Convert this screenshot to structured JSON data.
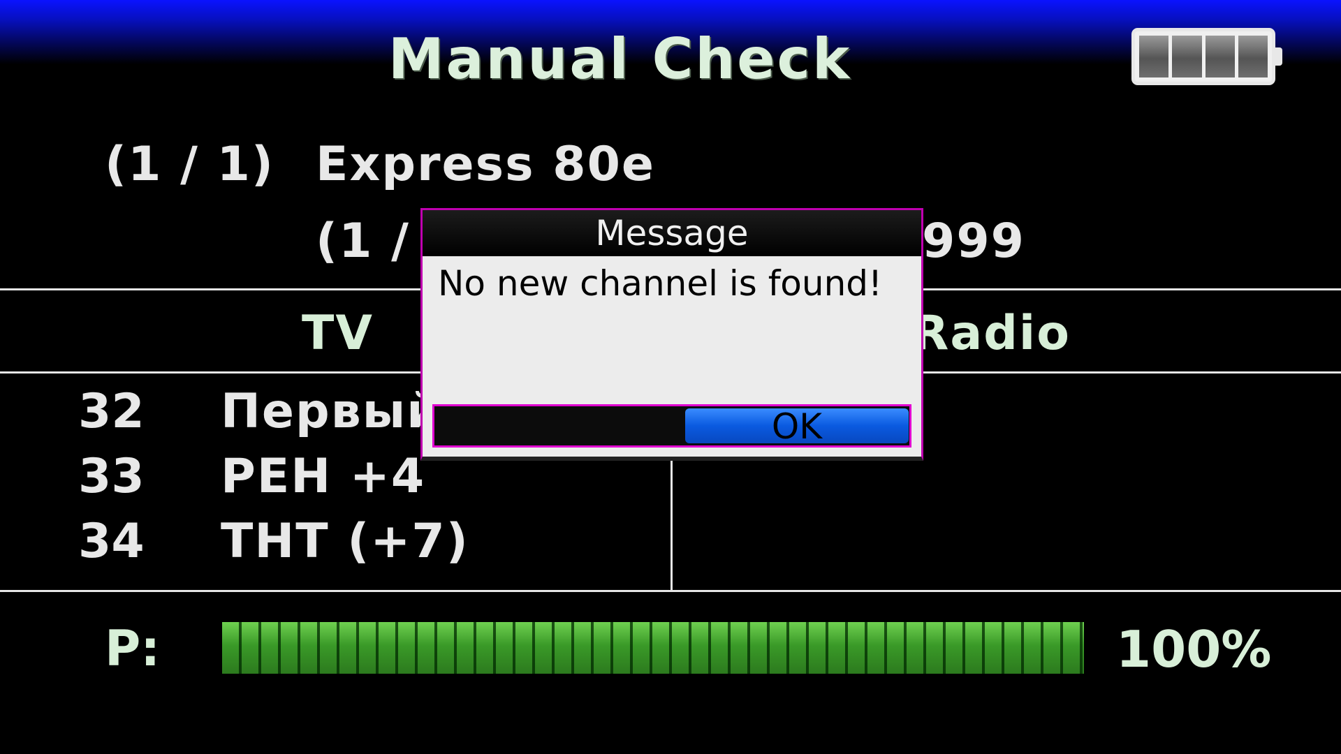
{
  "header": {
    "title": "Manual Check",
    "battery_icon": "battery-full-icon"
  },
  "satellite": {
    "index": "(1 / 1)",
    "name": "Express 80e"
  },
  "transponder": {
    "index": "(1 /",
    "value_tail": "999"
  },
  "columns": {
    "tv": "TV",
    "radio": "Radio"
  },
  "tv_channels": [
    {
      "number": "32",
      "name": "Первый"
    },
    {
      "number": "33",
      "name": "РЕН +4"
    },
    {
      "number": "34",
      "name": "ТНТ (+7)"
    }
  ],
  "progress": {
    "label": "P:",
    "value_text": "100%",
    "fraction": 1.0,
    "color": "#3a9a28"
  },
  "dialog": {
    "title": "Message",
    "message": "No new channel is found!",
    "ok_label": "OK",
    "border_color": "#e000d0",
    "button_color": "#0a5ae0"
  }
}
